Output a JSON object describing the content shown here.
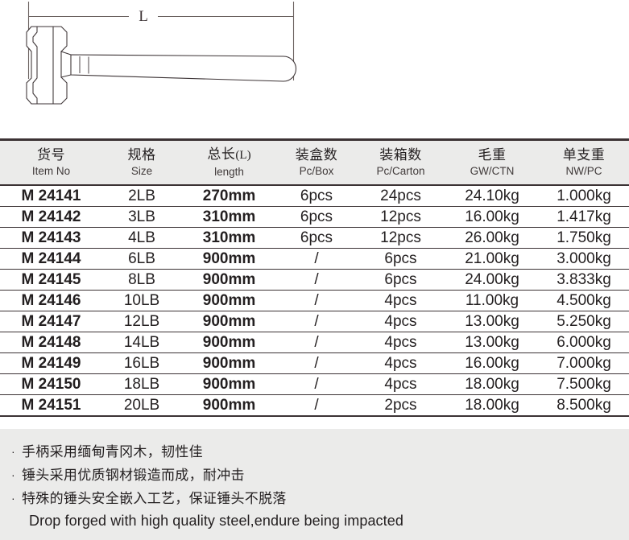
{
  "illustration": {
    "dimension_label": "L",
    "icon": "sledgehammer-outline-drawing"
  },
  "table": {
    "columns": [
      {
        "cn": "货号",
        "en": "Item No",
        "key": "item_no"
      },
      {
        "cn": "规格",
        "en": "Size",
        "key": "size"
      },
      {
        "cn": "总长",
        "cn_paren": "(L)",
        "en": "length",
        "key": "length"
      },
      {
        "cn": "装盒数",
        "en": "Pc/Box",
        "key": "pc_box"
      },
      {
        "cn": "装箱数",
        "en": "Pc/Carton",
        "key": "pc_carton"
      },
      {
        "cn": "毛重",
        "en": "GW/CTN",
        "key": "gw_ctn"
      },
      {
        "cn": "单支重",
        "en": "NW/PC",
        "key": "nw_pc"
      }
    ],
    "rows": [
      {
        "item_no": "M 24141",
        "size": "2LB",
        "length": "270mm",
        "pc_box": "6pcs",
        "pc_carton": "24pcs",
        "gw_ctn": "24.10kg",
        "nw_pc": "1.000kg"
      },
      {
        "item_no": "M 24142",
        "size": "3LB",
        "length": "310mm",
        "pc_box": "6pcs",
        "pc_carton": "12pcs",
        "gw_ctn": "16.00kg",
        "nw_pc": "1.417kg"
      },
      {
        "item_no": "M 24143",
        "size": "4LB",
        "length": "310mm",
        "pc_box": "6pcs",
        "pc_carton": "12pcs",
        "gw_ctn": "26.00kg",
        "nw_pc": "1.750kg"
      },
      {
        "item_no": "M 24144",
        "size": "6LB",
        "length": "900mm",
        "pc_box": "/",
        "pc_carton": "6pcs",
        "gw_ctn": "21.00kg",
        "nw_pc": "3.000kg"
      },
      {
        "item_no": "M 24145",
        "size": "8LB",
        "length": "900mm",
        "pc_box": "/",
        "pc_carton": "6pcs",
        "gw_ctn": "24.00kg",
        "nw_pc": "3.833kg"
      },
      {
        "item_no": "M 24146",
        "size": "10LB",
        "length": "900mm",
        "pc_box": "/",
        "pc_carton": "4pcs",
        "gw_ctn": "11.00kg",
        "nw_pc": "4.500kg"
      },
      {
        "item_no": "M 24147",
        "size": "12LB",
        "length": "900mm",
        "pc_box": "/",
        "pc_carton": "4pcs",
        "gw_ctn": "13.00kg",
        "nw_pc": "5.250kg"
      },
      {
        "item_no": "M 24148",
        "size": "14LB",
        "length": "900mm",
        "pc_box": "/",
        "pc_carton": "4pcs",
        "gw_ctn": "13.00kg",
        "nw_pc": "6.000kg"
      },
      {
        "item_no": "M 24149",
        "size": "16LB",
        "length": "900mm",
        "pc_box": "/",
        "pc_carton": "4pcs",
        "gw_ctn": "16.00kg",
        "nw_pc": "7.000kg"
      },
      {
        "item_no": "M 24150",
        "size": "18LB",
        "length": "900mm",
        "pc_box": "/",
        "pc_carton": "4pcs",
        "gw_ctn": "18.00kg",
        "nw_pc": "7.500kg"
      },
      {
        "item_no": "M 24151",
        "size": "20LB",
        "length": "900mm",
        "pc_box": "/",
        "pc_carton": "2pcs",
        "gw_ctn": "18.00kg",
        "nw_pc": "8.500kg"
      }
    ]
  },
  "features": {
    "bullet": "·",
    "lines": [
      "手柄采用缅甸青冈木，韧性佳",
      "锤头采用优质钢材锻造而成，耐冲击",
      "特殊的锤头安全嵌入工艺，保证锤头不脱落"
    ],
    "english_line": "Drop forged with high quality steel,endure being impacted"
  },
  "colors": {
    "ink": "#231f20",
    "rule": "#3b3234",
    "panel_bg": "#ebebea",
    "page_bg": "#ffffff"
  }
}
